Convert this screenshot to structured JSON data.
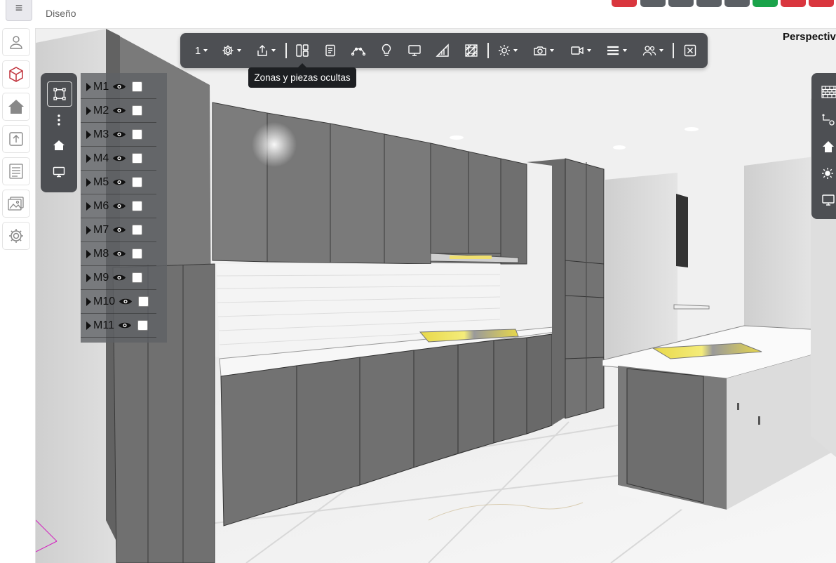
{
  "header": {
    "title": "Diseño",
    "menu_icon": "hamburger-icon",
    "action_buttons": [
      {
        "icon": "red-action-icon",
        "color": "#d9363e"
      },
      {
        "icon": "gray-action-icon",
        "color": "#5b5f64"
      },
      {
        "icon": "gray-action-icon",
        "color": "#5b5f64"
      },
      {
        "icon": "gray-action-icon",
        "color": "#5b5f64"
      },
      {
        "icon": "gray-action-icon",
        "color": "#5b5f64"
      },
      {
        "icon": "green-action-icon",
        "color": "#1aa34a"
      },
      {
        "icon": "red-action-icon",
        "color": "#d9363e"
      },
      {
        "icon": "red-action-icon",
        "color": "#d9363e"
      }
    ]
  },
  "sidebar": {
    "items": [
      {
        "icon": "user-icon"
      },
      {
        "icon": "cube-icon",
        "active": true,
        "color": "#c0303a"
      },
      {
        "icon": "house-icon"
      },
      {
        "icon": "upload-icon"
      },
      {
        "icon": "document-list-icon"
      },
      {
        "icon": "images-icon"
      },
      {
        "icon": "gear-icon"
      }
    ]
  },
  "toolbar": {
    "view_number": "1",
    "tooltip": "Zonas y piezas ocultas",
    "icons": [
      "settings-icon",
      "share-icon",
      "layout-icon",
      "document-icon",
      "curve-icon",
      "bulb-icon",
      "monitor-icon",
      "ruler-icon",
      "texture-icon",
      "sun-icon",
      "camera-icon",
      "video-icon",
      "lines-icon",
      "users-icon",
      "close-icon"
    ]
  },
  "view_tools": {
    "icons": [
      "select-frame-icon",
      "more-vertical-icon",
      "house-icon",
      "monitor-icon"
    ]
  },
  "modules": [
    {
      "label": "M1"
    },
    {
      "label": "M2"
    },
    {
      "label": "M3"
    },
    {
      "label": "M4"
    },
    {
      "label": "M5"
    },
    {
      "label": "M6"
    },
    {
      "label": "M7"
    },
    {
      "label": "M8"
    },
    {
      "label": "M9"
    },
    {
      "label": "M10"
    },
    {
      "label": "M11"
    }
  ],
  "view_label": "Perspectiv",
  "right_tools": {
    "icons": [
      "brick-wall-icon",
      "measure-icon",
      "home-upload-icon",
      "sun-icon",
      "monitor-icon"
    ]
  },
  "colors": {
    "accent": "#c0303a",
    "toolbar_bg": "#4d4f53",
    "cabinet": "#707070",
    "countertop": "#f4f4f4",
    "cooktop": "#e8d84a"
  }
}
